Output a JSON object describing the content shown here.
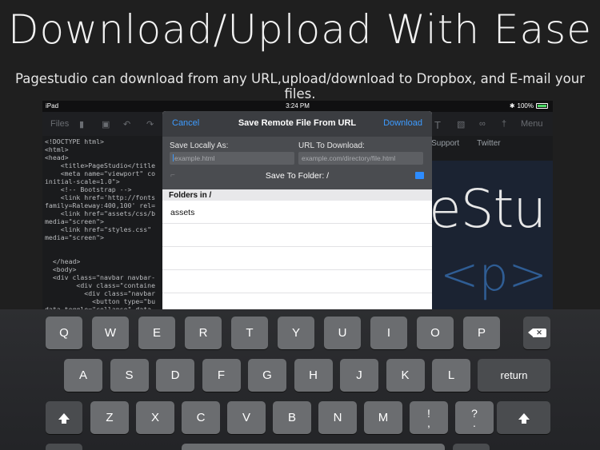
{
  "promo": {
    "headline": "Download/Upload With Ease",
    "subline": "Pagestudio can download from any URL,upload/download to Dropbox, and E-mail your files."
  },
  "status_bar": {
    "device": "iPad",
    "time": "3:24 PM",
    "battery": "100%"
  },
  "toolbar": {
    "files": "Files",
    "menu": "Menu"
  },
  "preview_tabs": [
    "elp/Support",
    "Twitter"
  ],
  "preview": {
    "big_text": "eStu",
    "tag_text": "<p>"
  },
  "code_lines": [
    "<!DOCTYPE html>",
    "<html>",
    "<head>",
    "    <title>PageStudio</title",
    "    <meta name=\"viewport\" co",
    "initial-scale=1.0\">",
    "    <!-- Bootstrap -->",
    "    <link href='http://fonts",
    "family=Raleway:400,100' rel=",
    "    <link href=\"assets/css/b",
    "media=\"screen\">",
    "    <link href=\"styles.css\"",
    "media=\"screen\">",
    "",
    "",
    "  </head>",
    "  <body>",
    "  <div class=\"navbar navbar-",
    "        <div class=\"containe",
    "          <div class=\"navbar",
    "            <button type=\"bu",
    "data-toggle=\"collapse\" data-"
  ],
  "dialog": {
    "cancel": "Cancel",
    "title": "Save Remote File From URL",
    "download": "Download",
    "save_locally_label": "Save Locally As:",
    "save_locally_placeholder": "example.html",
    "url_label": "URL To Download:",
    "url_placeholder": "example.com/directory/file.html",
    "save_to_folder": "Save To Folder: /",
    "folders_header": "Folders in /",
    "folders": [
      "assets"
    ]
  },
  "keyboard": {
    "row1": [
      "Q",
      "W",
      "E",
      "R",
      "T",
      "Y",
      "U",
      "I",
      "O",
      "P"
    ],
    "row2": [
      "A",
      "S",
      "D",
      "F",
      "G",
      "H",
      "J",
      "K",
      "L"
    ],
    "row3": [
      "Z",
      "X",
      "C",
      "V",
      "B",
      "N",
      "M",
      "!\n,",
      "?\n."
    ],
    "return": "return"
  },
  "colors": {
    "accent": "#3d9bff",
    "battery": "#4cd964",
    "background": "#1f1f1f"
  }
}
